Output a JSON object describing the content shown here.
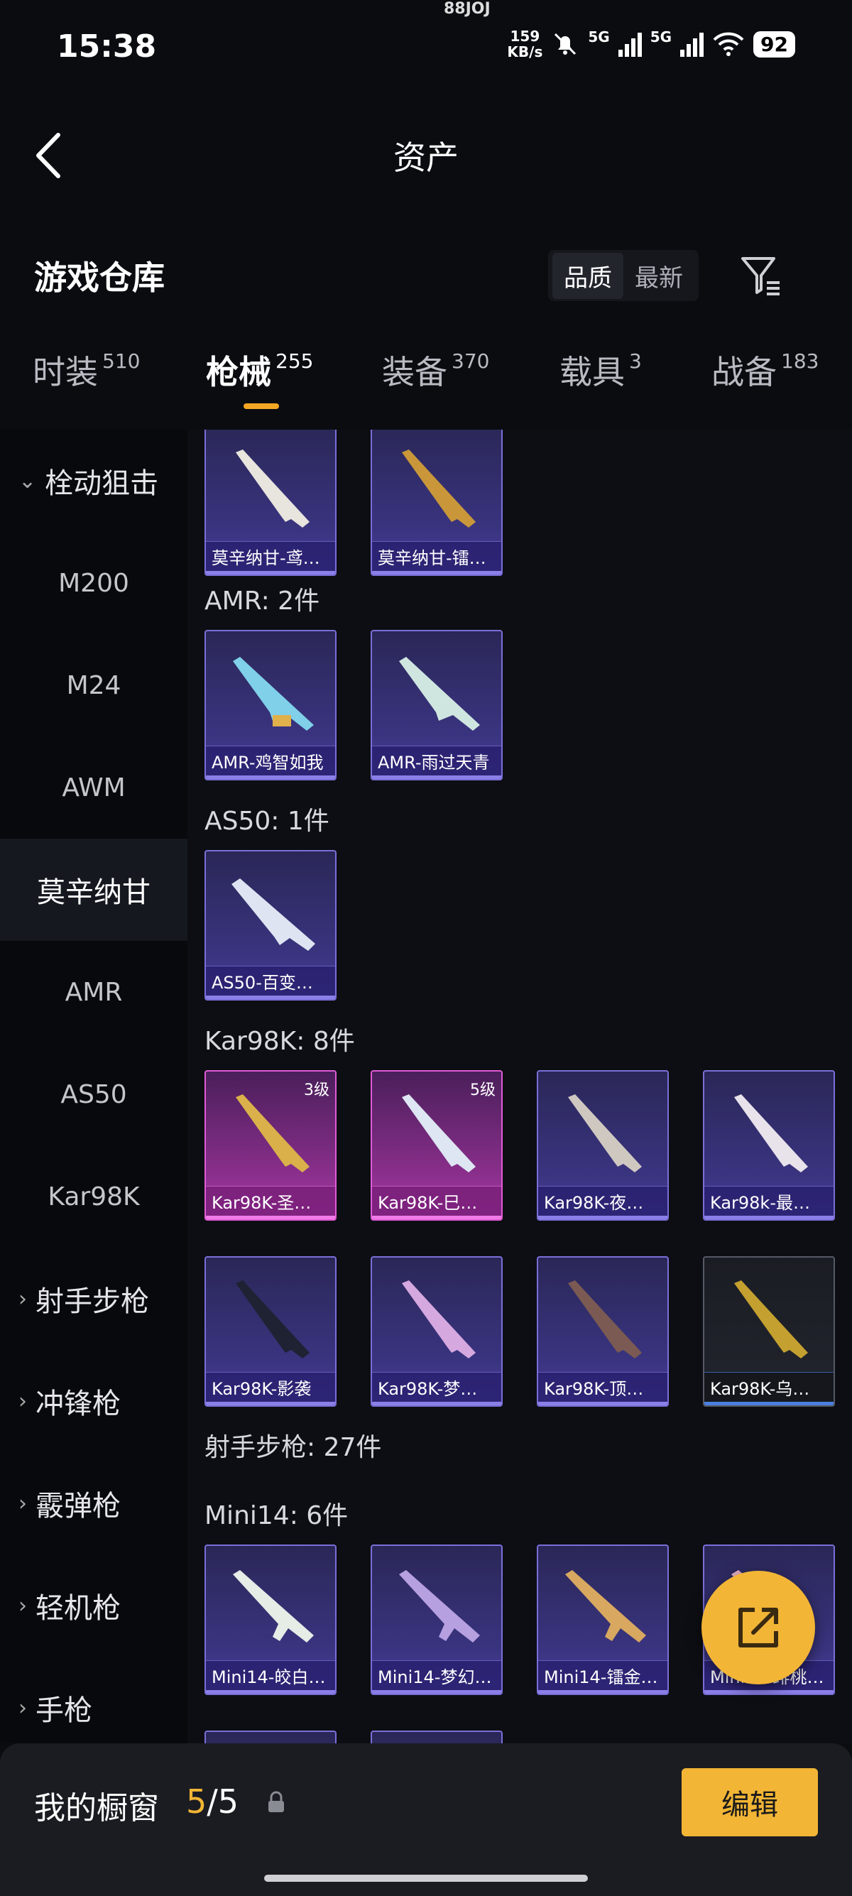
{
  "status": {
    "time": "15:38",
    "net_speed_value": "159",
    "net_speed_unit": "KB/s",
    "signal1": "5G",
    "signal2": "5G",
    "battery": "92",
    "notch_text": "88JOJ"
  },
  "header": {
    "title": "资产"
  },
  "section": {
    "title": "游戏仓库",
    "sort_options": [
      "品质",
      "最新"
    ],
    "sort_active": "品质"
  },
  "tabs": [
    {
      "label": "时装",
      "count": "510"
    },
    {
      "label": "枪械",
      "count": "255",
      "active": true
    },
    {
      "label": "装备",
      "count": "370"
    },
    {
      "label": "载具",
      "count": "3"
    },
    {
      "label": "战备",
      "count": "183"
    }
  ],
  "sidebar": {
    "items": [
      {
        "label": "栓动狙击",
        "type": "group",
        "expanded": true
      },
      {
        "label": "M200"
      },
      {
        "label": "M24"
      },
      {
        "label": "AWM"
      },
      {
        "label": "莫辛纳甘",
        "active": true
      },
      {
        "label": "AMR"
      },
      {
        "label": "AS50"
      },
      {
        "label": "Kar98K"
      },
      {
        "label": "射手步枪",
        "type": "group"
      },
      {
        "label": "冲锋枪",
        "type": "group"
      },
      {
        "label": "霰弹枪",
        "type": "group"
      },
      {
        "label": "轻机枪",
        "type": "group"
      },
      {
        "label": "手枪",
        "type": "group"
      }
    ]
  },
  "content": {
    "mosin_items": [
      "莫辛纳甘-鸢…",
      "莫辛纳甘-镭…"
    ],
    "amr": {
      "title": "AMR: 2件",
      "items": [
        "AMR-鸡智如我",
        "AMR-雨过天青"
      ]
    },
    "as50": {
      "title": "AS50: 1件",
      "items": [
        "AS50-百变…"
      ]
    },
    "kar98k": {
      "title": "Kar98K: 8件",
      "items": [
        {
          "name": "Kar98K-圣…",
          "level": "3级",
          "tier": "pink"
        },
        {
          "name": "Kar98K-巳…",
          "level": "5级",
          "tier": "pink"
        },
        {
          "name": "Kar98K-夜…",
          "tier": "purple"
        },
        {
          "name": "Kar98k-最…",
          "tier": "purple"
        },
        {
          "name": "Kar98K-影袭",
          "tier": "purple"
        },
        {
          "name": "Kar98K-梦…",
          "tier": "purple"
        },
        {
          "name": "Kar98K-顶…",
          "tier": "purple"
        },
        {
          "name": "Kar98K-乌…",
          "tier": "dark"
        }
      ]
    },
    "marksman_title": "射手步枪: 27件",
    "mini14": {
      "title": "Mini14: 6件",
      "items": [
        "Mini14-皎白…",
        "Mini14-梦幻…",
        "Mini14-镭金…",
        "Mini14-绯桃…"
      ]
    }
  },
  "bottom": {
    "window_label": "我的橱窗",
    "current": "5",
    "separator": "/",
    "total": "5",
    "edit_label": "编辑"
  },
  "colors": {
    "accent": "#f2b535",
    "purple_tier": "#7a6fd8",
    "pink_tier": "#e05bd6"
  }
}
